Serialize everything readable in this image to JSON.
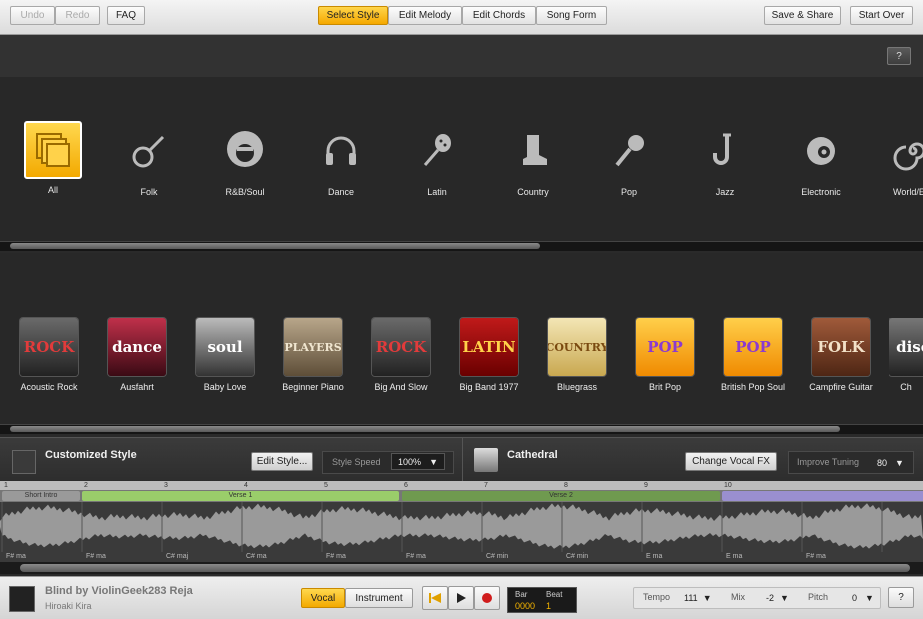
{
  "toolbar": {
    "undo": "Undo",
    "redo": "Redo",
    "faq": "FAQ",
    "tabs": [
      "Select Style",
      "Edit Melody",
      "Edit Chords",
      "Song Form"
    ],
    "save_share": "Save & Share",
    "start_over": "Start Over"
  },
  "help_label": "?",
  "categories": [
    "All",
    "Folk",
    "R&B/Soul",
    "Dance",
    "Latin",
    "Country",
    "Pop",
    "Jazz",
    "Electronic",
    "World/E"
  ],
  "styles": [
    {
      "name": "Acoustic Rock",
      "art": "ROCK"
    },
    {
      "name": "Ausfahrt",
      "art": "dance"
    },
    {
      "name": "Baby Love",
      "art": "soul"
    },
    {
      "name": "Beginner Piano",
      "art": "PLAYERS"
    },
    {
      "name": "Big And Slow",
      "art": "ROCK"
    },
    {
      "name": "Big Band 1977",
      "art": "LATIN"
    },
    {
      "name": "Bluegrass",
      "art": "COUNTRY"
    },
    {
      "name": "Brit Pop",
      "art": "POP"
    },
    {
      "name": "British Pop Soul",
      "art": "POP"
    },
    {
      "name": "Campfire Guitar",
      "art": "FOLK"
    },
    {
      "name": "Ch",
      "art": "disco"
    }
  ],
  "custom": {
    "title": "Customized Style",
    "edit_style": "Edit Style...",
    "speed_label": "Style Speed",
    "speed_value": "100%",
    "vocal_name": "Cathedral",
    "change_fx": "Change Vocal FX",
    "tuning_label": "Improve Tuning",
    "tuning_value": "80"
  },
  "timeline": {
    "bar_numbers": [
      "1",
      "2",
      "3",
      "4",
      "5",
      "6",
      "7",
      "8",
      "9",
      "10"
    ],
    "sections": [
      "Short Intro",
      "Verse 1",
      "Verse 2",
      ""
    ],
    "chords": [
      "F# ma",
      "F# ma",
      "C# maj",
      "C# ma",
      "F# ma",
      "F# ma",
      "C# min",
      "C# min",
      "E ma",
      "E ma",
      "F# ma"
    ]
  },
  "song": {
    "title": "Blind by ViolinGeek283 Reja",
    "artist": "Hiroaki Kira"
  },
  "transport": {
    "vocal": "Vocal",
    "instrument": "Instrument",
    "bar_label": "Bar",
    "beat_label": "Beat",
    "bar_value": "0000",
    "beat_value": "1"
  },
  "params": {
    "tempo_label": "Tempo",
    "tempo_value": "111",
    "mix_label": "Mix",
    "mix_value": "-2",
    "pitch_label": "Pitch",
    "pitch_value": "0"
  },
  "colors": {
    "accent": "#f5b400",
    "verse1": "#9acd6a",
    "verse2": "#6f9a4f",
    "section4": "#9a8fd0"
  }
}
